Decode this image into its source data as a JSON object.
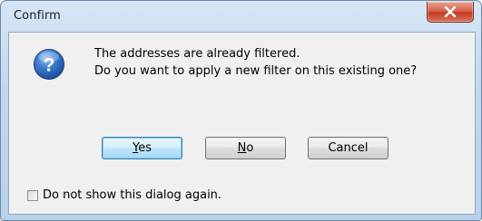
{
  "window": {
    "title": "Confirm"
  },
  "icons": {
    "close": "close-icon",
    "question": "question-icon"
  },
  "message": {
    "line1": "The addresses are already filtered.",
    "line2": "Do you want to apply a new filter on this existing one?"
  },
  "buttons": {
    "yes": {
      "access_key": "Y",
      "rest": "es"
    },
    "no": {
      "access_key": "N",
      "rest": "o"
    },
    "cancel": "Cancel"
  },
  "checkbox": {
    "label": "Do not show this dialog again.",
    "checked": false
  },
  "colors": {
    "close_button": "#c43b22",
    "default_button_border": "#3c7fb1",
    "question_icon": "#2a5fb4"
  }
}
